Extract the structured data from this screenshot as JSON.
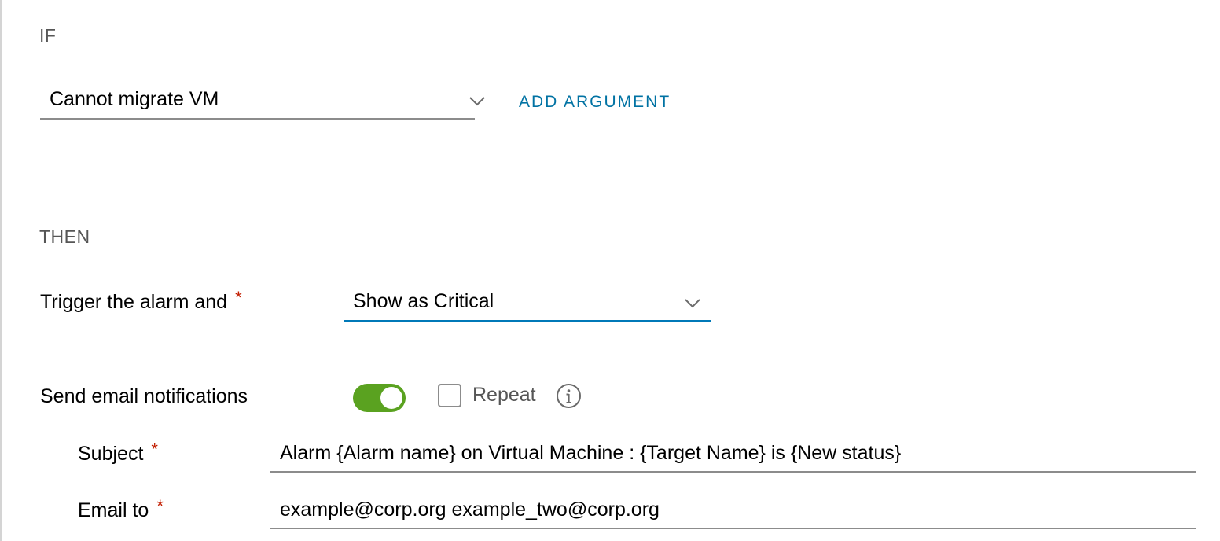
{
  "if_section": {
    "heading": "IF",
    "condition_select": {
      "value": "Cannot migrate VM",
      "icon": "chevron-down-icon"
    },
    "add_argument_label": "ADD ARGUMENT"
  },
  "then_section": {
    "heading": "THEN",
    "trigger": {
      "label": "Trigger the alarm and",
      "required_marker": "*",
      "select_value": "Show as Critical",
      "icon": "chevron-down-icon"
    },
    "email": {
      "label": "Send email notifications",
      "toggle_on": true,
      "repeat_label": "Repeat",
      "repeat_checked": false,
      "info_icon": "info-icon"
    },
    "subject": {
      "label": "Subject",
      "required_marker": "*",
      "value": "Alarm {Alarm name} on Virtual Machine : {Target Name} is {New status}"
    },
    "email_to": {
      "label": "Email to",
      "required_marker": "*",
      "value": "example@corp.org example_two@corp.org"
    }
  },
  "colors": {
    "accent": "#0079b8",
    "link": "#0072a3",
    "toggle_on": "#5aa220",
    "required": "#c21d00"
  }
}
